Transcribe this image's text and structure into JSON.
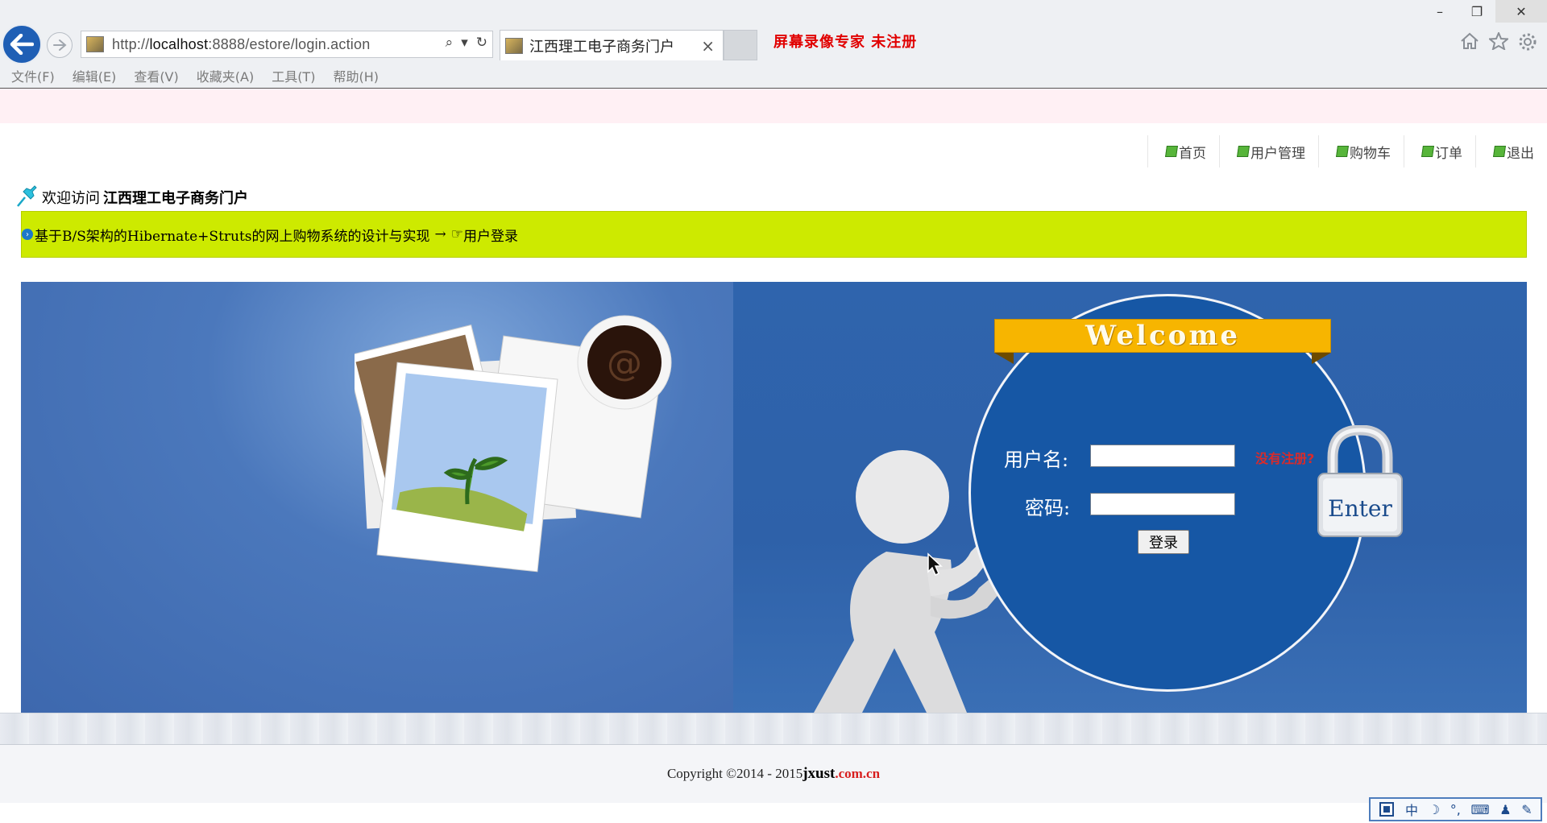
{
  "browser": {
    "url_prefix": "http://",
    "url_host": "localhost",
    "url_rest": ":8888/estore/login.action",
    "tab_title": "江西理工电子商务门户",
    "tab_close": "×",
    "recorder_banner": "屏幕录像专家  未注册",
    "window_controls": {
      "minimize": "–",
      "restore": "❐",
      "close": "✕"
    },
    "menu": [
      "文件(F)",
      "编辑(E)",
      "查看(V)",
      "收藏夹(A)",
      "工具(T)",
      "帮助(H)"
    ],
    "address_icons": {
      "search": "⌕",
      "dropdown": "▾",
      "refresh": "↻"
    }
  },
  "nav": {
    "items": [
      {
        "label": "首页",
        "icon": "edit-icon"
      },
      {
        "label": "用户管理",
        "icon": "edit-icon"
      },
      {
        "label": "购物车",
        "icon": "edit-icon"
      },
      {
        "label": "订单",
        "icon": "edit-icon"
      },
      {
        "label": "退出",
        "icon": "edit-icon"
      }
    ]
  },
  "welcome": {
    "prefix": "欢迎访问",
    "site_name": "江西理工电子商务门户"
  },
  "breadcrumb": {
    "project": "基于B/S架构的Hibernate+Struts的网上购物系统的设计与实现",
    "arrow": "→",
    "current_icon": "☞",
    "current": "用户登录"
  },
  "login": {
    "banner_title": "Welcome",
    "username_label": "用户名:",
    "password_label": "密码:",
    "username_value": "",
    "password_value": "",
    "register_link": "没有注册?",
    "submit_label": "登录",
    "lock_label": "Enter"
  },
  "footer": {
    "copyright": "Copyright ©2014 - 2015 ",
    "brand": "jxust",
    "domain": ".com.cn"
  },
  "ime": {
    "items": [
      "中",
      "☽",
      "°,",
      "⌨",
      "♟",
      "✎"
    ]
  },
  "colors": {
    "breadcrumb_bg": "#cdea00",
    "banner_blue": "#3f6fb4",
    "ribbon_gold": "#f7b500",
    "register_red": "#d82b2b",
    "nav_icon_green": "#57b53a"
  }
}
